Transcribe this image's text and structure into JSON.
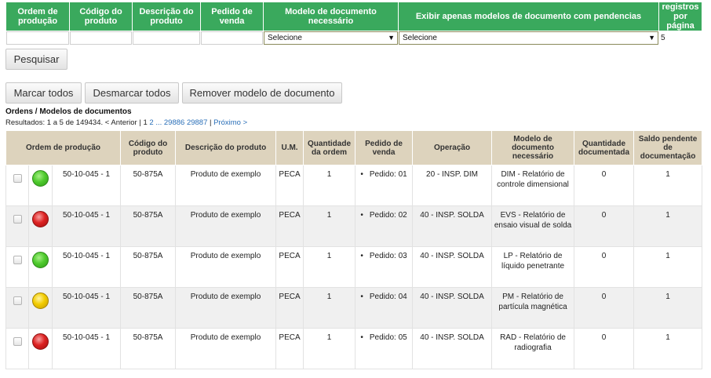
{
  "filters": {
    "headers": [
      "Ordem de produção",
      "Código do produto",
      "Descrição do produto",
      "Pedido de venda",
      "Modelo de documento necessário",
      "Exibir apenas modelos de documento com pendencias",
      "registros por página"
    ],
    "select_modelo": "Selecione",
    "select_pendencias": "Selecione",
    "registros_value": "5"
  },
  "buttons": {
    "pesquisar": "Pesquisar",
    "marcar_todos": "Marcar todos",
    "desmarcar_todos": "Desmarcar todos",
    "remover_modelo": "Remover modelo de documento"
  },
  "section_title": "Ordens / Modelos de documentos",
  "pager": {
    "summary": "Resultados: 1 a 5 de 149434.",
    "prev": "< Anterior",
    "sep1": "|",
    "current": "1",
    "p2": "2",
    "ellipsis": "...",
    "p29886": "29886",
    "p29887": "29887",
    "sep2": "|",
    "next": "Próximo >"
  },
  "table": {
    "headers": [
      "Ordem de produção",
      "Código do produto",
      "Descrição do produto",
      "U.M.",
      "Quantidade da ordem",
      "Pedido de venda",
      "Operação",
      "Modelo de documento necessário",
      "Quantidade documentada",
      "Saldo pendente de documentação"
    ],
    "rows": [
      {
        "status": "green",
        "ordem": "50-10-045 - 1",
        "codigo": "50-875A",
        "descricao": "Produto de exemplo",
        "um": "PECA",
        "qtd_ordem": "1",
        "pedido": "Pedido: 01",
        "operacao": "20 - INSP. DIM",
        "modelo": "DIM - Relatório de controle dimensional",
        "qtd_doc": "0",
        "saldo": "1"
      },
      {
        "status": "red",
        "ordem": "50-10-045 - 1",
        "codigo": "50-875A",
        "descricao": "Produto de exemplo",
        "um": "PECA",
        "qtd_ordem": "1",
        "pedido": "Pedido: 02",
        "operacao": "40 - INSP. SOLDA",
        "modelo": "EVS - Relatório de ensaio visual de solda",
        "qtd_doc": "0",
        "saldo": "1"
      },
      {
        "status": "green",
        "ordem": "50-10-045 - 1",
        "codigo": "50-875A",
        "descricao": "Produto de exemplo",
        "um": "PECA",
        "qtd_ordem": "1",
        "pedido": "Pedido: 03",
        "operacao": "40 - INSP. SOLDA",
        "modelo": "LP - Relatório de líquido penetrante",
        "qtd_doc": "0",
        "saldo": "1"
      },
      {
        "status": "yellow",
        "ordem": "50-10-045 - 1",
        "codigo": "50-875A",
        "descricao": "Produto de exemplo",
        "um": "PECA",
        "qtd_ordem": "1",
        "pedido": "Pedido: 04",
        "operacao": "40 - INSP. SOLDA",
        "modelo": "PM - Relatório de partícula magnética",
        "qtd_doc": "0",
        "saldo": "1"
      },
      {
        "status": "red",
        "ordem": "50-10-045 - 1",
        "codigo": "50-875A",
        "descricao": "Produto de exemplo",
        "um": "PECA",
        "qtd_ordem": "1",
        "pedido": "Pedido: 05",
        "operacao": "40 - INSP. SOLDA",
        "modelo": "RAD - Relatório de radiografia",
        "qtd_doc": "0",
        "saldo": "1"
      }
    ]
  },
  "colors": {
    "filter_header": "#3aa95d",
    "table_header": "#ddd3bd",
    "link": "#2a6fb8",
    "status_green": "#4fcb2e",
    "status_red": "#dd2222",
    "status_yellow": "#f2cc00"
  }
}
